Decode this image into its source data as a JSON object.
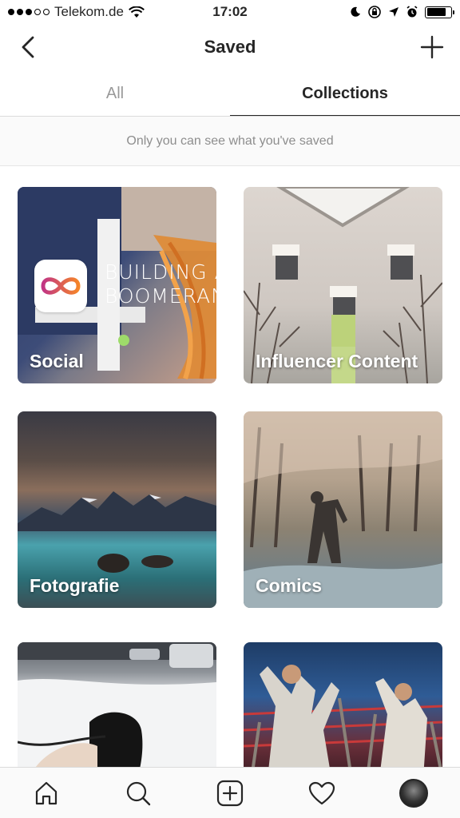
{
  "status_bar": {
    "carrier": "Telekom.de",
    "time": "17:02"
  },
  "nav": {
    "title": "Saved"
  },
  "tabs": [
    {
      "label": "All",
      "active": false
    },
    {
      "label": "Collections",
      "active": true
    }
  ],
  "notice": "Only you can see what you've saved",
  "collections": [
    {
      "label": "Social"
    },
    {
      "label": "Influencer Content"
    },
    {
      "label": "Fotografie"
    },
    {
      "label": "Comics"
    },
    {
      "label": ""
    },
    {
      "label": ""
    }
  ],
  "social_tile_text": {
    "line1": "BUILDING A",
    "line2": "BOOMERANG"
  },
  "tabbar": {
    "items": [
      "home-icon",
      "search-icon",
      "add-post-icon",
      "activity-heart-icon",
      "profile-avatar"
    ]
  },
  "colors": {
    "text_primary": "#262626",
    "text_secondary": "#8e8e8e",
    "divider": "#dbdbdb",
    "boomerang_gradient_start": "#e1306c",
    "boomerang_gradient_end": "#f58529"
  }
}
